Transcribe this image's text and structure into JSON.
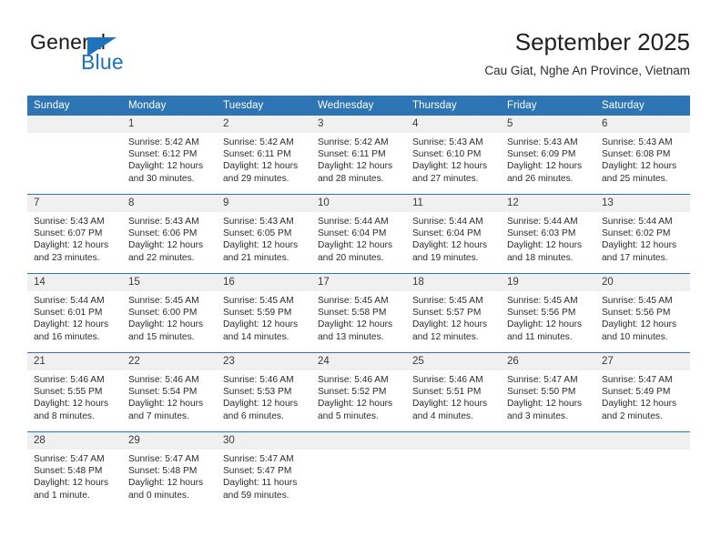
{
  "brand": {
    "name_part1": "General",
    "name_part2": "Blue",
    "triangle_color": "#1f73bd"
  },
  "header": {
    "title": "September 2025",
    "subtitle": "Cau Giat, Nghe An Province, Vietnam"
  },
  "theme": {
    "header_blue": "#2e75b6",
    "daynum_gray": "#f0f0f0",
    "text": "#2b2b2b"
  },
  "weekday_headers": [
    "Sunday",
    "Monday",
    "Tuesday",
    "Wednesday",
    "Thursday",
    "Friday",
    "Saturday"
  ],
  "weeks": [
    [
      {
        "day": "",
        "empty": true,
        "sunrise": "",
        "sunset": "",
        "daylight_line1": "",
        "daylight_line2": ""
      },
      {
        "day": "1",
        "sunrise": "Sunrise: 5:42 AM",
        "sunset": "Sunset: 6:12 PM",
        "daylight_line1": "Daylight: 12 hours",
        "daylight_line2": "and 30 minutes."
      },
      {
        "day": "2",
        "sunrise": "Sunrise: 5:42 AM",
        "sunset": "Sunset: 6:11 PM",
        "daylight_line1": "Daylight: 12 hours",
        "daylight_line2": "and 29 minutes."
      },
      {
        "day": "3",
        "sunrise": "Sunrise: 5:42 AM",
        "sunset": "Sunset: 6:11 PM",
        "daylight_line1": "Daylight: 12 hours",
        "daylight_line2": "and 28 minutes."
      },
      {
        "day": "4",
        "sunrise": "Sunrise: 5:43 AM",
        "sunset": "Sunset: 6:10 PM",
        "daylight_line1": "Daylight: 12 hours",
        "daylight_line2": "and 27 minutes."
      },
      {
        "day": "5",
        "sunrise": "Sunrise: 5:43 AM",
        "sunset": "Sunset: 6:09 PM",
        "daylight_line1": "Daylight: 12 hours",
        "daylight_line2": "and 26 minutes."
      },
      {
        "day": "6",
        "sunrise": "Sunrise: 5:43 AM",
        "sunset": "Sunset: 6:08 PM",
        "daylight_line1": "Daylight: 12 hours",
        "daylight_line2": "and 25 minutes."
      }
    ],
    [
      {
        "day": "7",
        "sunrise": "Sunrise: 5:43 AM",
        "sunset": "Sunset: 6:07 PM",
        "daylight_line1": "Daylight: 12 hours",
        "daylight_line2": "and 23 minutes."
      },
      {
        "day": "8",
        "sunrise": "Sunrise: 5:43 AM",
        "sunset": "Sunset: 6:06 PM",
        "daylight_line1": "Daylight: 12 hours",
        "daylight_line2": "and 22 minutes."
      },
      {
        "day": "9",
        "sunrise": "Sunrise: 5:43 AM",
        "sunset": "Sunset: 6:05 PM",
        "daylight_line1": "Daylight: 12 hours",
        "daylight_line2": "and 21 minutes."
      },
      {
        "day": "10",
        "sunrise": "Sunrise: 5:44 AM",
        "sunset": "Sunset: 6:04 PM",
        "daylight_line1": "Daylight: 12 hours",
        "daylight_line2": "and 20 minutes."
      },
      {
        "day": "11",
        "sunrise": "Sunrise: 5:44 AM",
        "sunset": "Sunset: 6:04 PM",
        "daylight_line1": "Daylight: 12 hours",
        "daylight_line2": "and 19 minutes."
      },
      {
        "day": "12",
        "sunrise": "Sunrise: 5:44 AM",
        "sunset": "Sunset: 6:03 PM",
        "daylight_line1": "Daylight: 12 hours",
        "daylight_line2": "and 18 minutes."
      },
      {
        "day": "13",
        "sunrise": "Sunrise: 5:44 AM",
        "sunset": "Sunset: 6:02 PM",
        "daylight_line1": "Daylight: 12 hours",
        "daylight_line2": "and 17 minutes."
      }
    ],
    [
      {
        "day": "14",
        "sunrise": "Sunrise: 5:44 AM",
        "sunset": "Sunset: 6:01 PM",
        "daylight_line1": "Daylight: 12 hours",
        "daylight_line2": "and 16 minutes."
      },
      {
        "day": "15",
        "sunrise": "Sunrise: 5:45 AM",
        "sunset": "Sunset: 6:00 PM",
        "daylight_line1": "Daylight: 12 hours",
        "daylight_line2": "and 15 minutes."
      },
      {
        "day": "16",
        "sunrise": "Sunrise: 5:45 AM",
        "sunset": "Sunset: 5:59 PM",
        "daylight_line1": "Daylight: 12 hours",
        "daylight_line2": "and 14 minutes."
      },
      {
        "day": "17",
        "sunrise": "Sunrise: 5:45 AM",
        "sunset": "Sunset: 5:58 PM",
        "daylight_line1": "Daylight: 12 hours",
        "daylight_line2": "and 13 minutes."
      },
      {
        "day": "18",
        "sunrise": "Sunrise: 5:45 AM",
        "sunset": "Sunset: 5:57 PM",
        "daylight_line1": "Daylight: 12 hours",
        "daylight_line2": "and 12 minutes."
      },
      {
        "day": "19",
        "sunrise": "Sunrise: 5:45 AM",
        "sunset": "Sunset: 5:56 PM",
        "daylight_line1": "Daylight: 12 hours",
        "daylight_line2": "and 11 minutes."
      },
      {
        "day": "20",
        "sunrise": "Sunrise: 5:45 AM",
        "sunset": "Sunset: 5:56 PM",
        "daylight_line1": "Daylight: 12 hours",
        "daylight_line2": "and 10 minutes."
      }
    ],
    [
      {
        "day": "21",
        "sunrise": "Sunrise: 5:46 AM",
        "sunset": "Sunset: 5:55 PM",
        "daylight_line1": "Daylight: 12 hours",
        "daylight_line2": "and 8 minutes."
      },
      {
        "day": "22",
        "sunrise": "Sunrise: 5:46 AM",
        "sunset": "Sunset: 5:54 PM",
        "daylight_line1": "Daylight: 12 hours",
        "daylight_line2": "and 7 minutes."
      },
      {
        "day": "23",
        "sunrise": "Sunrise: 5:46 AM",
        "sunset": "Sunset: 5:53 PM",
        "daylight_line1": "Daylight: 12 hours",
        "daylight_line2": "and 6 minutes."
      },
      {
        "day": "24",
        "sunrise": "Sunrise: 5:46 AM",
        "sunset": "Sunset: 5:52 PM",
        "daylight_line1": "Daylight: 12 hours",
        "daylight_line2": "and 5 minutes."
      },
      {
        "day": "25",
        "sunrise": "Sunrise: 5:46 AM",
        "sunset": "Sunset: 5:51 PM",
        "daylight_line1": "Daylight: 12 hours",
        "daylight_line2": "and 4 minutes."
      },
      {
        "day": "26",
        "sunrise": "Sunrise: 5:47 AM",
        "sunset": "Sunset: 5:50 PM",
        "daylight_line1": "Daylight: 12 hours",
        "daylight_line2": "and 3 minutes."
      },
      {
        "day": "27",
        "sunrise": "Sunrise: 5:47 AM",
        "sunset": "Sunset: 5:49 PM",
        "daylight_line1": "Daylight: 12 hours",
        "daylight_line2": "and 2 minutes."
      }
    ],
    [
      {
        "day": "28",
        "sunrise": "Sunrise: 5:47 AM",
        "sunset": "Sunset: 5:48 PM",
        "daylight_line1": "Daylight: 12 hours",
        "daylight_line2": "and 1 minute."
      },
      {
        "day": "29",
        "sunrise": "Sunrise: 5:47 AM",
        "sunset": "Sunset: 5:48 PM",
        "daylight_line1": "Daylight: 12 hours",
        "daylight_line2": "and 0 minutes."
      },
      {
        "day": "30",
        "sunrise": "Sunrise: 5:47 AM",
        "sunset": "Sunset: 5:47 PM",
        "daylight_line1": "Daylight: 11 hours",
        "daylight_line2": "and 59 minutes."
      },
      {
        "day": "",
        "empty": true,
        "sunrise": "",
        "sunset": "",
        "daylight_line1": "",
        "daylight_line2": ""
      },
      {
        "day": "",
        "empty": true,
        "sunrise": "",
        "sunset": "",
        "daylight_line1": "",
        "daylight_line2": ""
      },
      {
        "day": "",
        "empty": true,
        "sunrise": "",
        "sunset": "",
        "daylight_line1": "",
        "daylight_line2": ""
      },
      {
        "day": "",
        "empty": true,
        "sunrise": "",
        "sunset": "",
        "daylight_line1": "",
        "daylight_line2": ""
      }
    ]
  ]
}
